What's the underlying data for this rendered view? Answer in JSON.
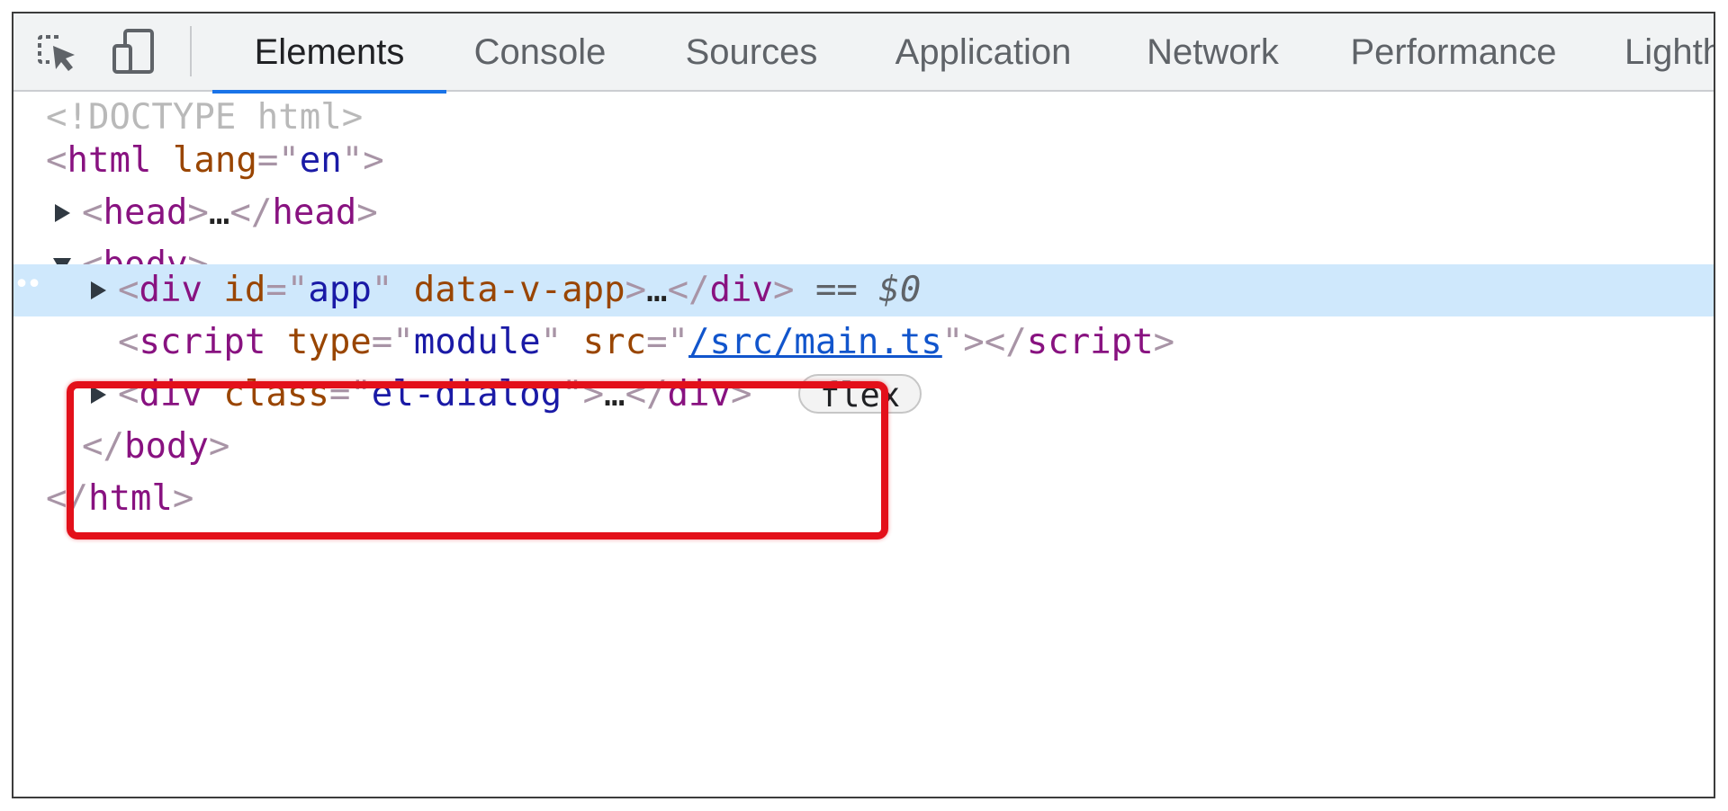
{
  "toolbar": {
    "icons": [
      "inspect-element-icon",
      "device-toolbar-icon"
    ],
    "tabs": [
      {
        "label": "Elements",
        "active": true
      },
      {
        "label": "Console",
        "active": false
      },
      {
        "label": "Sources",
        "active": false
      },
      {
        "label": "Application",
        "active": false
      },
      {
        "label": "Network",
        "active": false
      },
      {
        "label": "Performance",
        "active": false
      },
      {
        "label": "Lighth",
        "active": false
      }
    ],
    "accent_color": "#1a73e8"
  },
  "tree": {
    "doctype": "<!DOCTYPE html>",
    "html_open": {
      "lt": "<",
      "tag": "html",
      "attr": "lang",
      "eq": "=\"",
      "value": "en",
      "close": "\">"
    },
    "head": {
      "lt": "<",
      "tag": "head",
      "gt": ">",
      "ellipsis": "…",
      "end_lt": "</",
      "end_tag": "head",
      "end_gt": ">"
    },
    "body_open": {
      "lt": "<",
      "tag": "body",
      "gt": ">"
    },
    "div_app": {
      "lt": "<",
      "tag": "div",
      "attr1": "id",
      "eq1": "=\"",
      "value1": "app",
      "q1": "\"",
      "attr2": "data-v-app",
      "gt": ">",
      "ellipsis": "…",
      "end_lt": "</",
      "end_tag": "div",
      "end_gt": ">",
      "selector": "== $0",
      "dots": "••"
    },
    "script": {
      "lt": "<",
      "tag": "script",
      "attr1": "type",
      "eq1": "=\"",
      "value1": "module",
      "q1": "\"",
      "attr2": "src",
      "eq2": "=\"",
      "value2": "/src/main.ts",
      "q2": "\">",
      "end_lt": "</",
      "end_tag": "script",
      "end_gt": ">"
    },
    "div_dialog": {
      "lt": "<",
      "tag": "div",
      "attr": "class",
      "eq": "=\"",
      "value": "el-dialog",
      "q": "\">",
      "ellipsis": "…",
      "end_lt": "</",
      "end_tag": "div",
      "end_gt": ">",
      "badge": "flex"
    },
    "body_close": {
      "lt": "</",
      "tag": "body",
      "gt": ">"
    },
    "html_close": {
      "lt": "</",
      "tag": "html",
      "gt": ">"
    },
    "selected_row_color": "#cfe8fc",
    "annotation_color": "#e3101a"
  }
}
